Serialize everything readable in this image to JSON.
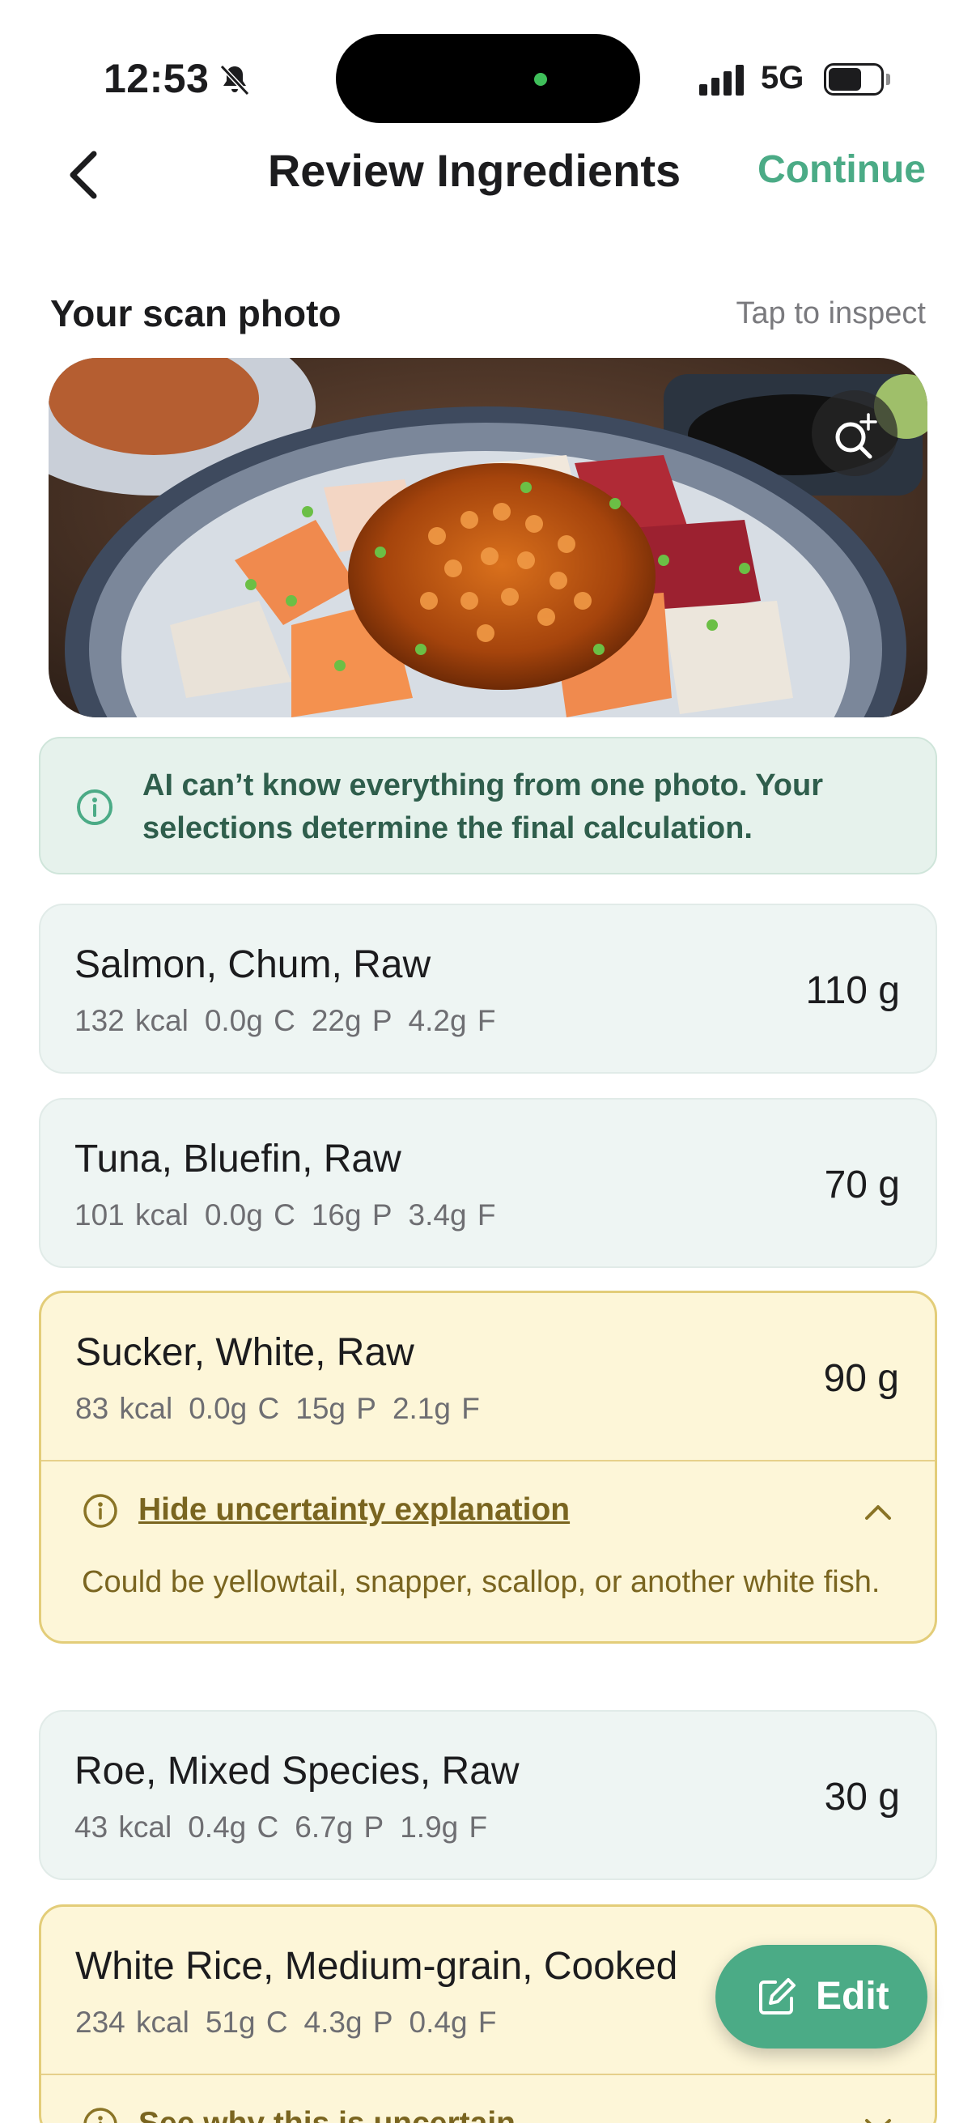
{
  "status_bar": {
    "time": "12:53",
    "network": "5G"
  },
  "nav": {
    "title": "Review Ingredients",
    "continue_label": "Continue"
  },
  "scan": {
    "title": "Your scan photo",
    "hint": "Tap to inspect"
  },
  "banner": {
    "text": "AI can’t know everything from one photo. Your selections determine the final calculation."
  },
  "ingredients": [
    {
      "name": "Salmon, Chum, Raw",
      "kcal": "132 kcal",
      "carbs": "0.0g C",
      "protein": "22g P",
      "fat": "4.2g F",
      "quantity": "110 g",
      "uncertain": false
    },
    {
      "name": "Tuna, Bluefin, Raw",
      "kcal": "101 kcal",
      "carbs": "0.0g C",
      "protein": "16g P",
      "fat": "3.4g F",
      "quantity": "70 g",
      "uncertain": false
    },
    {
      "name": "Sucker, White, Raw",
      "kcal": "83 kcal",
      "carbs": "0.0g C",
      "protein": "15g P",
      "fat": "2.1g F",
      "quantity": "90 g",
      "uncertain": true,
      "uncertainty_toggle": "Hide uncertainty explanation",
      "uncertainty_text": "Could be yellowtail, snapper, scallop, or another white fish."
    },
    {
      "name": "Roe, Mixed Species, Raw",
      "kcal": "43 kcal",
      "carbs": "0.4g C",
      "protein": "6.7g P",
      "fat": "1.9g F",
      "quantity": "30 g",
      "uncertain": false
    },
    {
      "name": "White Rice, Medium-grain, Cooked",
      "kcal": "234 kcal",
      "carbs": "51g C",
      "protein": "4.3g P",
      "fat": "0.4g F",
      "quantity": "",
      "uncertain": true,
      "uncertainty_toggle": "See why this is uncertain"
    }
  ],
  "fab": {
    "label": "Edit"
  },
  "colors": {
    "accent": "#4bab86",
    "warning_bg": "#fdf6d8",
    "warning_border": "#e3cd79",
    "neutral_card_bg": "#eef5f3",
    "banner_bg": "#e6f2ec"
  },
  "icons": [
    "bell-slash-icon",
    "signal-icon",
    "battery-icon",
    "back-chevron-icon",
    "zoom-in-icon",
    "info-icon",
    "chevron-up-icon",
    "chevron-down-icon",
    "edit-icon"
  ]
}
